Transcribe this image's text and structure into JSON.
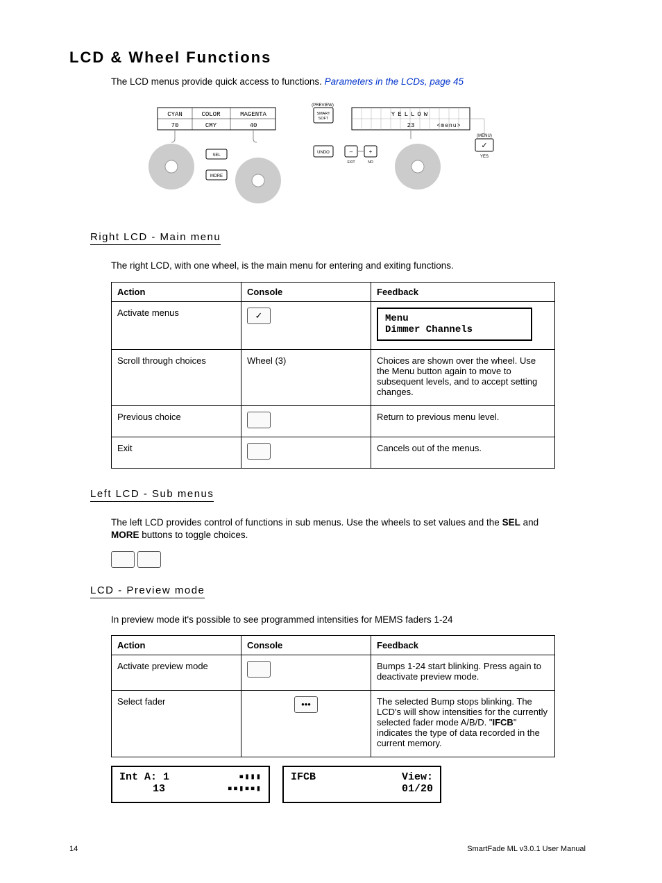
{
  "heading": "LCD & Wheel Functions",
  "intro_pre": "The LCD menus provide quick access to functions. ",
  "intro_link": "Parameters in the LCDs, page 45",
  "figure": {
    "left_lcd": {
      "l1": "CYAN",
      "l2": "COLOR",
      "l3": "MAGENTA",
      "v1": "70",
      "v2": "CMY",
      "v3": "40"
    },
    "left_btns": {
      "sel": "SEL",
      "more": "MORE"
    },
    "mid": {
      "preview": "(PREVIEW)",
      "smart": "SMART",
      "soft": "SOFT",
      "undo": "UNDO",
      "minus": "–",
      "plus": "+",
      "exit": "EXIT",
      "no": "NO"
    },
    "right_lcd": {
      "label": "YELLOW",
      "val": "23",
      "menu": "<menu>"
    },
    "right_btns": {
      "menu_label": "(MENU)",
      "check": "✓",
      "yes": "YES"
    }
  },
  "right_lcd_heading": "Right LCD - Main menu",
  "right_lcd_body": "The right LCD, with one wheel, is the main menu for entering and exiting functions.",
  "tbl_headers": {
    "action": "Action",
    "console": "Console",
    "feedback": "Feedback"
  },
  "table1": {
    "r1_action": "Activate menus",
    "r1_console_icon": "✓",
    "r1_fb_l1": "Menu",
    "r1_fb_l2": "Dimmer Channels",
    "r2_action": "Scroll through choices",
    "r2_console": "Wheel (3)",
    "r2_feedback": "Choices are shown over the wheel. Use the Menu button again to move to subsequent levels, and to accept setting changes.",
    "r3_action": "Previous choice",
    "r3_feedback": "Return to previous menu level.",
    "r4_action": "Exit",
    "r4_feedback": "Cancels out of the menus."
  },
  "left_lcd_heading": "Left LCD - Sub menus",
  "left_lcd_body_pre": "The left LCD provides control of functions in sub menus. Use the wheels to set values and the ",
  "left_lcd_sel": "SEL",
  "left_lcd_mid": " and ",
  "left_lcd_more": "MORE",
  "left_lcd_body_post": " buttons to toggle choices.",
  "preview_heading": "LCD - Preview mode",
  "preview_body": "In preview mode it's possible to see programmed intensities for MEMS faders 1-24",
  "table2": {
    "r1_action": "Activate preview mode",
    "r1_feedback": "Bumps 1-24 start blinking. Press again to deactivate preview mode.",
    "r2_action": "Select fader",
    "r2_console_icon": "•••",
    "r2_feedback_pre": "The selected Bump stops blinking. The LCD's will show intensities for the currently selected fader mode A/B/D. \"",
    "r2_feedback_bold": "IFCB",
    "r2_feedback_post": "\" indicates the type of data recorded in the current memory."
  },
  "panels": {
    "left_l1a": "Int A: 1",
    "left_l2a": "13",
    "left_bars1": "▪▮▮▮",
    "left_bars2": "▪▪▮▪▪▮",
    "right_l1a": "IFCB",
    "right_l1b": "View:",
    "right_l2b": "01/20"
  },
  "footer": {
    "page": "14",
    "manual": "SmartFade ML v3.0.1 User Manual"
  }
}
